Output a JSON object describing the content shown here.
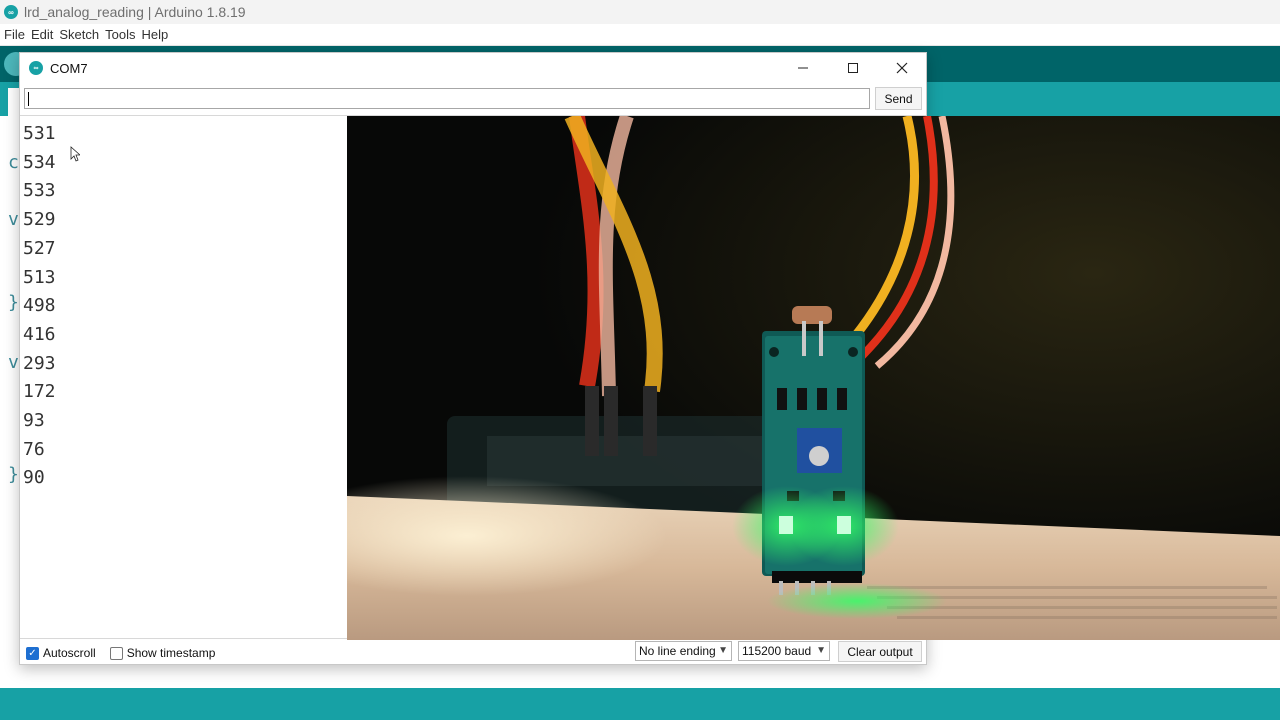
{
  "app": {
    "title": "lrd_analog_reading | Arduino 1.8.19",
    "menu": [
      "File",
      "Edit",
      "Sketch",
      "Tools",
      "Help"
    ]
  },
  "editor_hints": [
    "c",
    "v",
    "}",
    "v",
    "}"
  ],
  "serial": {
    "title": "COM7",
    "input_value": "",
    "send_label": "Send",
    "lines": [
      "531",
      "534",
      "533",
      "529",
      "527",
      "513",
      "498",
      "416",
      "293",
      "172",
      "93",
      "76",
      "90"
    ],
    "autoscroll_label": "Autoscroll",
    "autoscroll_checked": true,
    "timestamp_label": "Show timestamp",
    "timestamp_checked": false,
    "line_ending": "No line ending",
    "baud": "115200 baud",
    "clear_label": "Clear output",
    "min_icon": "minimize-icon",
    "max_icon": "maximize-icon",
    "close_icon": "close-icon"
  },
  "colors": {
    "arduino_teal": "#17a1a5",
    "arduino_dark": "#006468",
    "led_green": "#22ff55"
  }
}
